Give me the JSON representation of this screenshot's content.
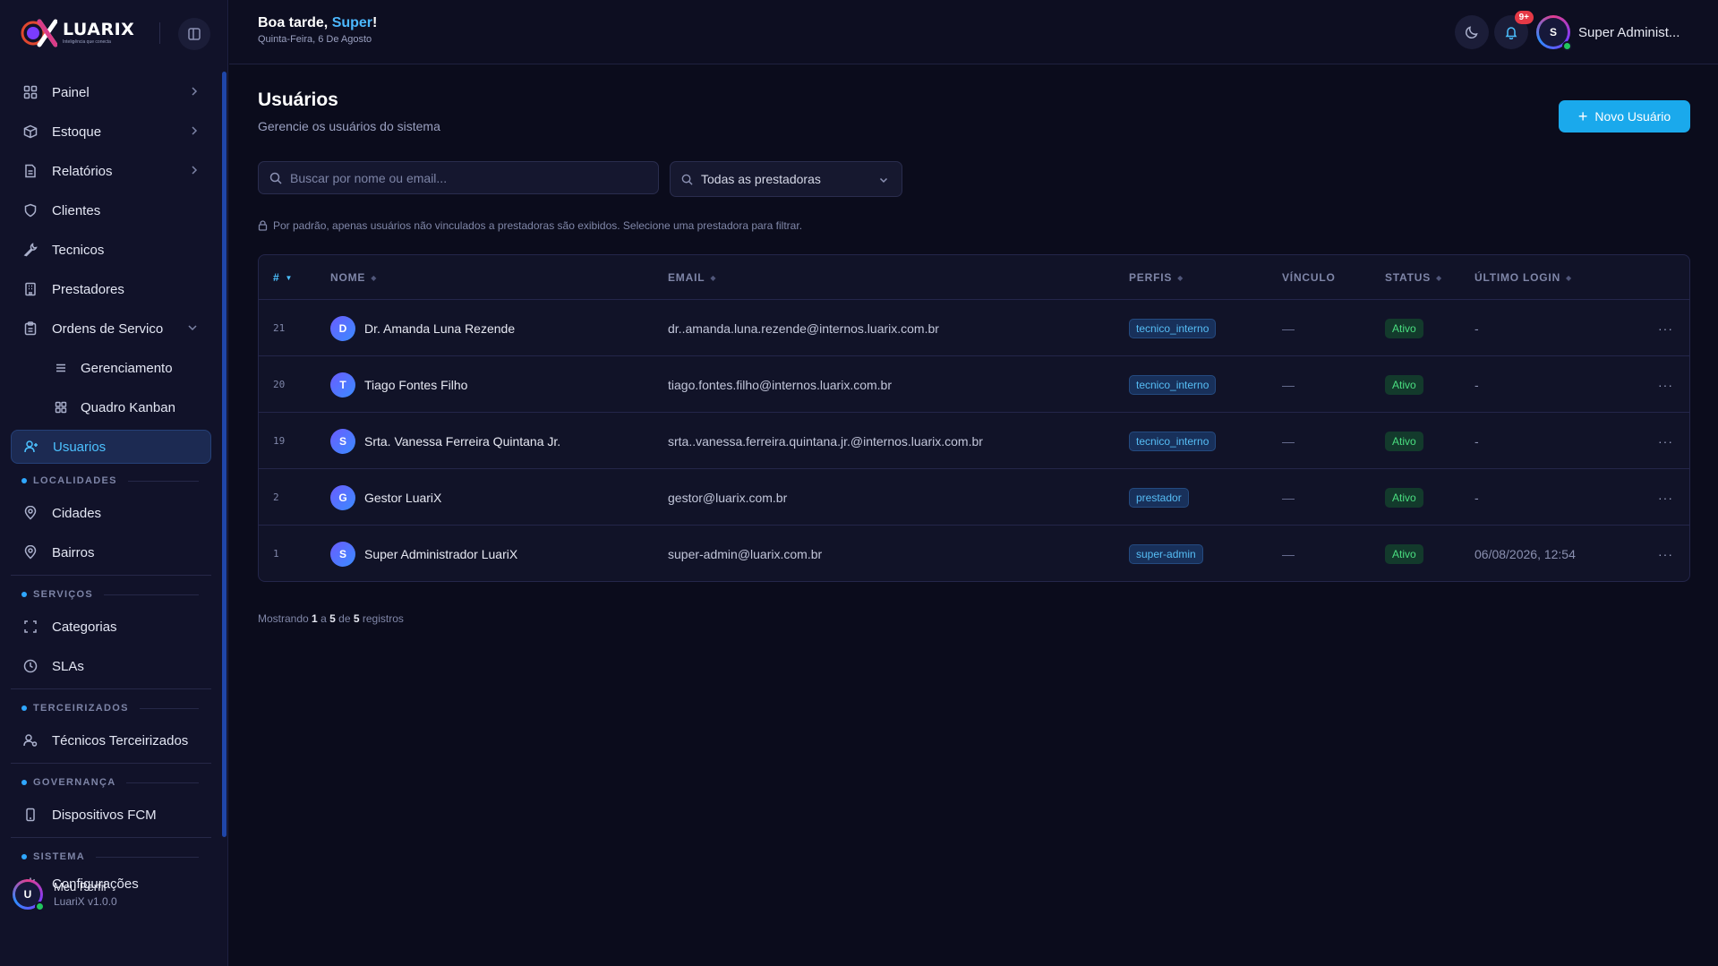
{
  "brand": {
    "name": "LUARIX",
    "tagline": "Inteligência que conecta"
  },
  "greeting": {
    "prefix": "Boa tarde, ",
    "user": "Super",
    "suffix": "!",
    "date": "Quinta-Feira, 6 De Agosto"
  },
  "topbar": {
    "notification_badge": "9+",
    "user_initial": "S",
    "user_name": "Super Administ..."
  },
  "sidebar": {
    "items": [
      {
        "label": "Painel",
        "icon": "grid-icon"
      },
      {
        "label": "Estoque",
        "icon": "box-icon"
      },
      {
        "label": "Relatórios",
        "icon": "file-icon"
      },
      {
        "label": "Clientes",
        "icon": "shield-icon"
      },
      {
        "label": "Tecnicos",
        "icon": "wrench-icon"
      },
      {
        "label": "Prestadores",
        "icon": "building-icon"
      },
      {
        "label": "Ordens de Servico",
        "icon": "clipboard-icon"
      }
    ],
    "subitems": [
      {
        "label": "Gerenciamento",
        "icon": "list-icon"
      },
      {
        "label": "Quadro Kanban",
        "icon": "kanban-icon"
      }
    ],
    "active": {
      "label": "Usuarios",
      "icon": "users-icon"
    },
    "sections": {
      "localidades": "LOCALIDADES",
      "servicos": "SERVIÇOS",
      "terceirizados": "TERCEIRIZADOS",
      "governanca": "GOVERNANÇA",
      "sistema": "SISTEMA"
    },
    "localidades_items": [
      {
        "label": "Cidades"
      },
      {
        "label": "Bairros"
      }
    ],
    "servicos_items": [
      {
        "label": "Categorias"
      },
      {
        "label": "SLAs"
      }
    ],
    "terceirizados_items": [
      {
        "label": "Técnicos Terceirizados"
      }
    ],
    "governanca_items": [
      {
        "label": "Dispositivos FCM"
      }
    ],
    "sistema_items": [
      {
        "label": "Configurações"
      }
    ]
  },
  "profile": {
    "initial": "U",
    "name": "Meu Perfil",
    "version": "LuariX v1.0.0"
  },
  "page": {
    "title": "Usuários",
    "subtitle": "Gerencie os usuários do sistema",
    "new_button": "Novo Usuário",
    "search_placeholder": "Buscar por nome ou email...",
    "filter_value": "Todas as prestadoras",
    "hint": "Por padrão, apenas usuários não vinculados a prestadoras são exibidos. Selecione uma prestadora para filtrar."
  },
  "table": {
    "headers": {
      "id": "#",
      "name": "NOME",
      "email": "EMAIL",
      "perfis": "PERFIS",
      "vinculo": "VÍNCULO",
      "status": "STATUS",
      "login": "ÚLTIMO LOGIN"
    },
    "rows": [
      {
        "id": "21",
        "initial": "D",
        "name": "Dr. Amanda Luna Rezende",
        "email": "dr..amanda.luna.rezende@internos.luarix.com.br",
        "perfil": "tecnico_interno",
        "vinculo": "—",
        "status": "Ativo",
        "login": "-"
      },
      {
        "id": "20",
        "initial": "T",
        "name": "Tiago Fontes Filho",
        "email": "tiago.fontes.filho@internos.luarix.com.br",
        "perfil": "tecnico_interno",
        "vinculo": "—",
        "status": "Ativo",
        "login": "-"
      },
      {
        "id": "19",
        "initial": "S",
        "name": "Srta. Vanessa Ferreira Quintana Jr.",
        "email": "srta..vanessa.ferreira.quintana.jr.@internos.luarix.com.br",
        "perfil": "tecnico_interno",
        "vinculo": "—",
        "status": "Ativo",
        "login": "-"
      },
      {
        "id": "2",
        "initial": "G",
        "name": "Gestor LuariX",
        "email": "gestor@luarix.com.br",
        "perfil": "prestador",
        "vinculo": "—",
        "status": "Ativo",
        "login": "-"
      },
      {
        "id": "1",
        "initial": "S",
        "name": "Super Administrador LuariX",
        "email": "super-admin@luarix.com.br",
        "perfil": "super-admin",
        "vinculo": "—",
        "status": "Ativo",
        "login": "06/08/2026, 12:54"
      }
    ],
    "actions_glyph": "···"
  },
  "footer": {
    "prefix": "Mostrando",
    "from": "1",
    "a": "a",
    "to": "5",
    "de": "de",
    "total": "5",
    "suffix": "registros"
  },
  "colors": {
    "accent": "#1aa9ec",
    "active_text": "#4cc1ff",
    "status_green": "#4ade80",
    "badge_red": "#e53946"
  }
}
